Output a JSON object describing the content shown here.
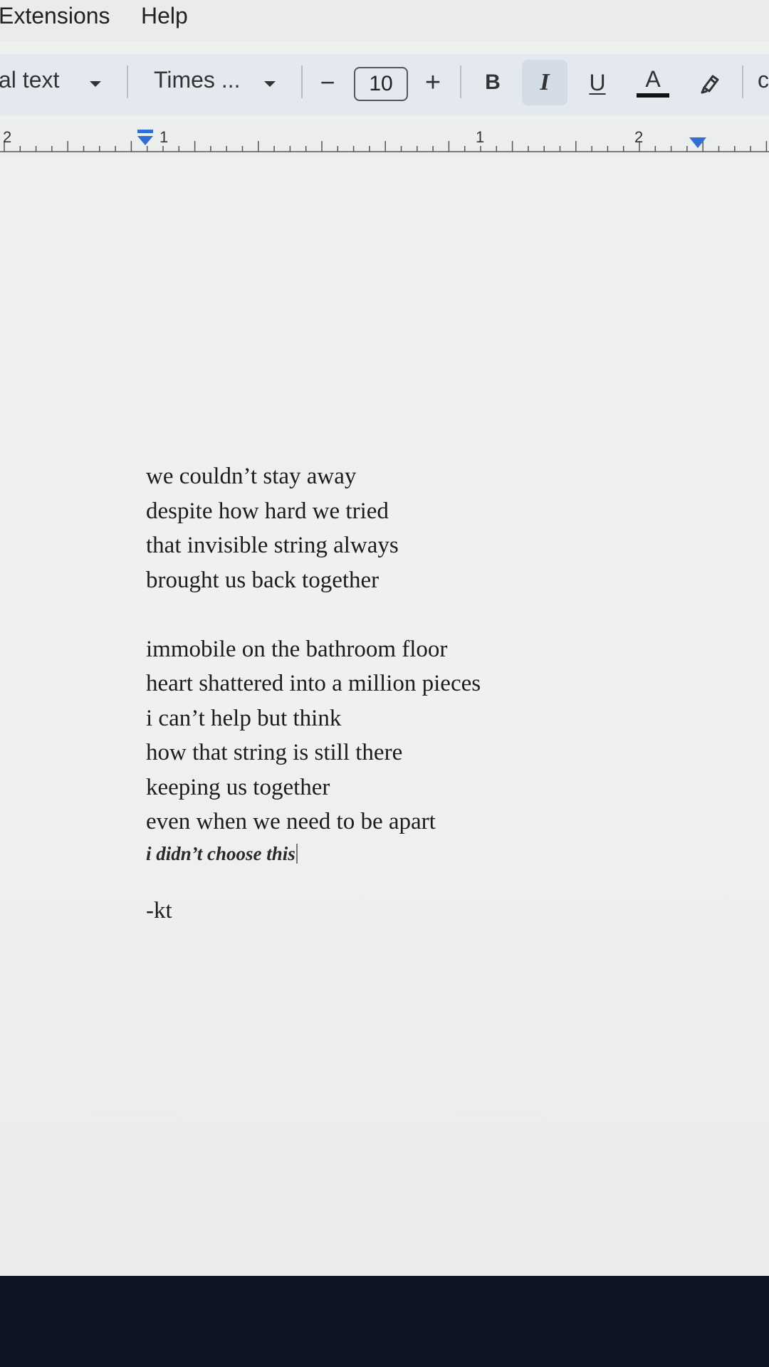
{
  "menu": {
    "items": [
      "Extensions",
      "Help"
    ]
  },
  "toolbar": {
    "style_label": "al text",
    "font_label": "Times ...",
    "decrease_label": "−",
    "font_size": "10",
    "increase_label": "+",
    "bold_label": "B",
    "italic_label": "I",
    "underline_label": "U",
    "text_color_label": "A",
    "truncated_label": "c",
    "colors": {
      "italic_active_bg": "#d3dbe6",
      "text_color_underline": "#111111"
    }
  },
  "ruler": {
    "numbers": [
      "2",
      "1",
      "1",
      "2"
    ],
    "marker_color": "#2f6fd6"
  },
  "document": {
    "stanza1": [
      "we couldn’t stay away",
      "despite how hard we tried",
      "that invisible string always",
      "brought us back together"
    ],
    "stanza2": [
      "immobile on the bathroom floor",
      "heart shattered into a million pieces",
      "i can’t help but think",
      "how that string is still there",
      "keeping us together",
      "even when we need to be apart"
    ],
    "italic_line": "i didn’t choose this",
    "signature": "-kt"
  }
}
